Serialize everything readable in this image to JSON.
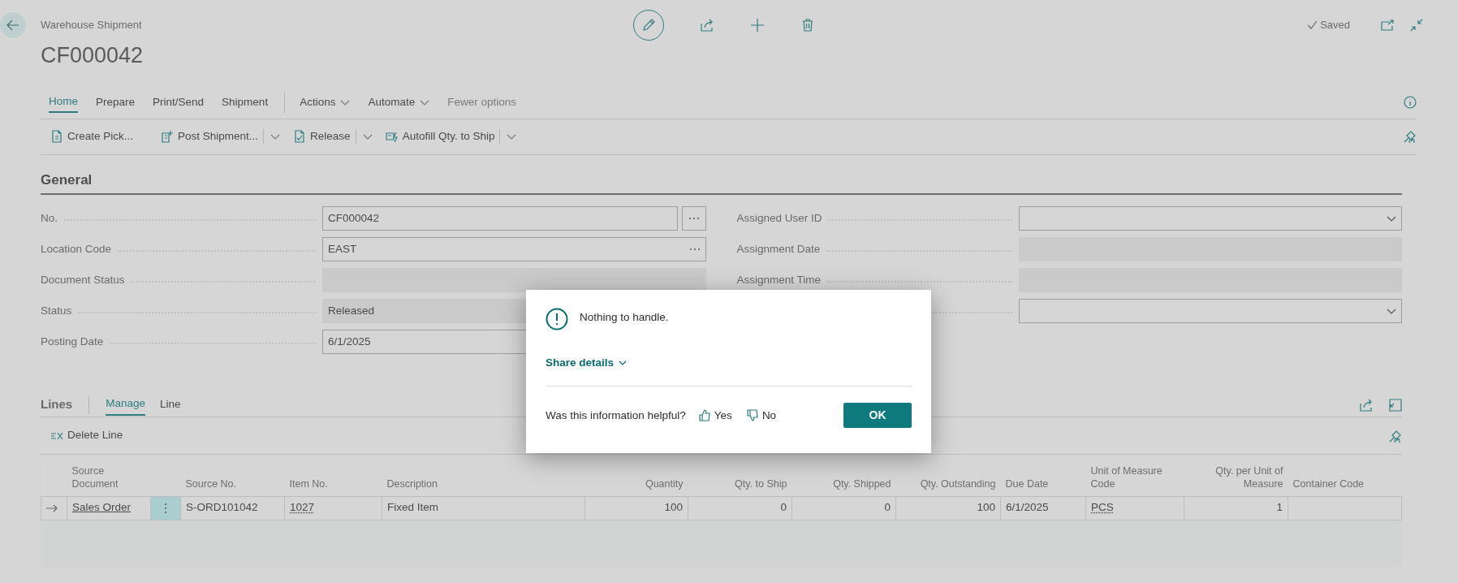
{
  "header": {
    "page_type": "Warehouse Shipment",
    "title": "CF000042",
    "save_status": "Saved"
  },
  "tabs": [
    {
      "label": "Home",
      "selected": true
    },
    {
      "label": "Prepare",
      "selected": false
    },
    {
      "label": "Print/Send",
      "selected": false
    },
    {
      "label": "Shipment",
      "selected": false
    }
  ],
  "menus": [
    {
      "label": "Actions",
      "kind": "dropdown"
    },
    {
      "label": "Automate",
      "kind": "dropdown"
    },
    {
      "label": "Fewer options",
      "kind": "link"
    }
  ],
  "actions": [
    {
      "label": "Create Pick...",
      "kind": "pick",
      "split": false
    },
    {
      "label": "Post Shipment...",
      "kind": "post",
      "split": true
    },
    {
      "label": "Release",
      "kind": "release",
      "split": true
    },
    {
      "label": "Autofill Qty. to Ship",
      "kind": "autofill",
      "split": true
    }
  ],
  "general": {
    "title": "General",
    "left_fields": [
      {
        "label": "No.",
        "value": "CF000042",
        "kind": "lookup"
      },
      {
        "label": "Location Code",
        "value": "EAST",
        "kind": "inline-lookup"
      },
      {
        "label": "Document Status",
        "kind": "readonly"
      },
      {
        "label": "Status",
        "value": "Released",
        "kind": "readonly"
      },
      {
        "label": "Posting Date",
        "value": "6/1/2025",
        "kind": "text"
      }
    ],
    "right_fields": [
      {
        "label": "Assigned User ID",
        "kind": "dropdown"
      },
      {
        "label": "Assignment Date",
        "kind": "readonly"
      },
      {
        "label": "Assignment Time",
        "kind": "readonly"
      },
      {
        "kind": "dropdown"
      }
    ]
  },
  "lines": {
    "title": "Lines",
    "tabs": [
      {
        "label": "Manage",
        "selected": true
      },
      {
        "label": "Line",
        "selected": false
      }
    ],
    "actions": [
      "Delete Line"
    ],
    "columns": [
      {
        "label": "Source Document",
        "kind": "link"
      },
      {
        "label": "Source No.",
        "kind": "text"
      },
      {
        "label": "Item No.",
        "kind": "lookup"
      },
      {
        "label": "Description",
        "kind": "text"
      },
      {
        "label": "Quantity",
        "kind": "number"
      },
      {
        "label": "Qty. to Ship",
        "kind": "number"
      },
      {
        "label": "Qty. Shipped",
        "kind": "number"
      },
      {
        "label": "Qty. Outstanding",
        "kind": "number"
      },
      {
        "label": "Due Date",
        "kind": "text"
      },
      {
        "label": "Unit of Measure Code",
        "kind": "lookup"
      },
      {
        "label": "Qty. per Unit of Measure",
        "kind": "number"
      },
      {
        "label": "Container Code",
        "kind": "text"
      }
    ],
    "rows": [
      {
        "current": true,
        "cells": [
          "Sales Order",
          "S-ORD101042",
          "1027",
          "Fixed Item",
          "100",
          "0",
          "0",
          "100",
          "6/1/2025",
          "PCS",
          "1",
          ""
        ]
      }
    ]
  },
  "dialog": {
    "message": "Nothing to handle.",
    "share_details": "Share details",
    "feedback_question": "Was this information helpful?",
    "feedback": [
      "Yes",
      "No"
    ],
    "ok": "OK"
  }
}
